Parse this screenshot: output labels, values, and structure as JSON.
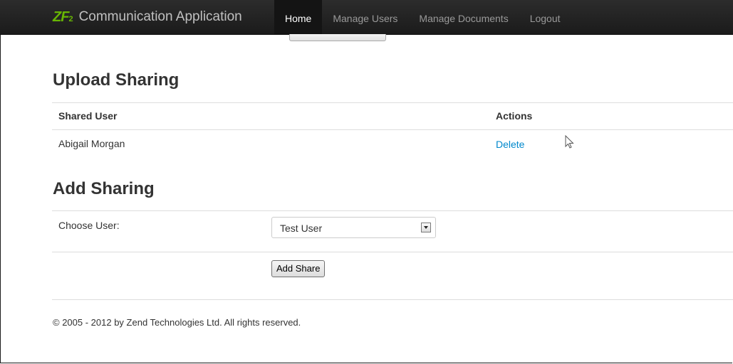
{
  "app": {
    "brand_logo": "ZF2",
    "brand_text": "Communication Application"
  },
  "nav": {
    "items": [
      {
        "label": "Home",
        "active": true
      },
      {
        "label": "Manage Users",
        "active": false
      },
      {
        "label": "Manage Documents",
        "active": false
      },
      {
        "label": "Logout",
        "active": false
      }
    ]
  },
  "upload_sharing": {
    "title": "Upload Sharing",
    "columns": [
      "Shared User",
      "Actions"
    ],
    "rows": [
      {
        "user": "Abigail Morgan",
        "action": "Delete"
      }
    ]
  },
  "add_sharing": {
    "title": "Add Sharing",
    "choose_user_label": "Choose User:",
    "selected_user": "Test User",
    "submit_label": "Add Share"
  },
  "footer": {
    "text": "© 2005 - 2012 by Zend Technologies Ltd. All rights reserved."
  },
  "colors": {
    "navbar": "#1b1b1b",
    "logo_green": "#68b604",
    "link": "#0088cc"
  }
}
